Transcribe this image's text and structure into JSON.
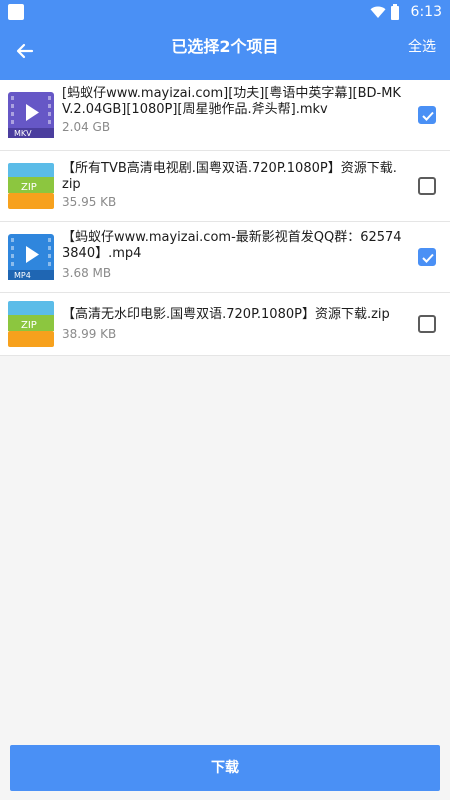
{
  "status": {
    "time": "6:13"
  },
  "toolbar": {
    "title": "已选择2个项目",
    "select_all_label": "全选"
  },
  "files": [
    {
      "name": "[蚂蚁仔www.mayizai.com][功夫][粤语中英字幕][BD-MKV.2.04GB][1080P][周星驰作品.斧头帮].mkv",
      "size": "2.04 GB",
      "icon": "mkv-video-file-icon",
      "badge": "MKV",
      "checked": true
    },
    {
      "name": "【所有TVB高清电视剧.国粤双语.720P.1080P】资源下载.zip",
      "size": "35.95 KB",
      "icon": "zip-archive-icon",
      "badge": "ZIP",
      "checked": false
    },
    {
      "name": "【蚂蚁仔www.mayizai.com-最新影视首发QQ群：625743840】.mp4",
      "size": "3.68 MB",
      "icon": "mp4-video-file-icon",
      "badge": "MP4",
      "checked": true
    },
    {
      "name": "【高清无水印电影.国粤双语.720P.1080P】资源下载.zip",
      "size": "38.99 KB",
      "icon": "zip-archive-icon",
      "badge": "ZIP",
      "checked": false
    }
  ],
  "download_label": "下载",
  "colors": {
    "accent": "#4a90f5",
    "mkv_icon": "#6657c6",
    "mp4_icon": "#2f86dd",
    "zip_top": "#5bbce8",
    "zip_mid": "#8cc63f",
    "zip_bottom": "#f7a11d"
  }
}
